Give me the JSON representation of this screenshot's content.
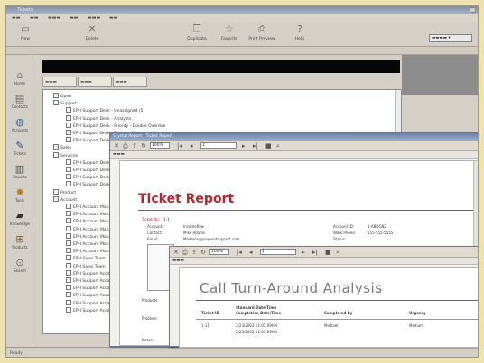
{
  "app": {
    "title": "Tickets"
  },
  "colors": {
    "accent_red": "#b02a32",
    "window_bg": "#d4d0c8",
    "background": "#ede3b0"
  },
  "toolbar": {
    "buttons": [
      {
        "icon": "new-icon",
        "label": "New"
      },
      {
        "icon": "delete-icon",
        "label": "Delete"
      },
      {
        "icon": "duplicate-icon",
        "label": "Duplicate"
      },
      {
        "icon": "favorite-icon",
        "label": "Favorite"
      },
      {
        "icon": "print-icon",
        "label": "Print Preview"
      },
      {
        "icon": "help-icon",
        "label": "Help"
      }
    ]
  },
  "leftbar": {
    "items": [
      {
        "icon": "home-icon",
        "label": "Home"
      },
      {
        "icon": "contacts-icon",
        "label": "Contacts"
      },
      {
        "icon": "globe-icon",
        "label": "Accounts"
      },
      {
        "icon": "pen-icon",
        "label": "Tickets"
      },
      {
        "icon": "chart-icon",
        "label": "Reports"
      },
      {
        "icon": "gear-icon",
        "label": "Tools"
      },
      {
        "icon": "book-icon",
        "label": "Knowledge"
      },
      {
        "icon": "box-icon",
        "label": "Products"
      },
      {
        "icon": "search-icon",
        "label": "Search"
      }
    ]
  },
  "tree": {
    "nodes": [
      {
        "text": "Open",
        "indent": 1
      },
      {
        "text": "Support",
        "indent": 1
      },
      {
        "text": "EPH Support Desk - Unassigned (5)",
        "indent": 3
      },
      {
        "text": "EPH Support Desk - Analysts",
        "indent": 3
      },
      {
        "text": "EPH Support Desk - Priority - Double Overdue",
        "indent": 3
      },
      {
        "text": "EPH Support Desk - Priority - Overdue (4)",
        "indent": 3
      },
      {
        "text": "EPH Support Desk",
        "indent": 3
      },
      {
        "text": "Sales",
        "indent": 1
      },
      {
        "text": "Services",
        "indent": 1
      },
      {
        "text": "EPH Support Desk",
        "indent": 3
      },
      {
        "text": "EPH Support Desk",
        "indent": 3
      },
      {
        "text": "EPH Support Desk",
        "indent": 3
      },
      {
        "text": "EPH Support Desk",
        "indent": 3
      },
      {
        "text": "Product",
        "indent": 1
      },
      {
        "text": "Account",
        "indent": 1
      },
      {
        "text": "EPH Account Mana",
        "indent": 3
      },
      {
        "text": "EPH Account Mana",
        "indent": 3
      },
      {
        "text": "EPH Account Mana",
        "indent": 3
      },
      {
        "text": "EPH Account Mana",
        "indent": 3
      },
      {
        "text": "EPH Account Mana",
        "indent": 3
      },
      {
        "text": "EPH Account Mana",
        "indent": 3
      },
      {
        "text": "EPH Account Mana",
        "indent": 3
      },
      {
        "text": "EPH Sales Team",
        "indent": 3
      },
      {
        "text": "EPH Sales Team",
        "indent": 3
      },
      {
        "text": "EPH Support Acco",
        "indent": 3
      },
      {
        "text": "EPH Support Acco",
        "indent": 3
      },
      {
        "text": "EPH Support Acco",
        "indent": 3
      },
      {
        "text": "EPH Support Acco",
        "indent": 3
      },
      {
        "text": "EPH Support Acco",
        "indent": 3
      },
      {
        "text": "EPH Support Acco",
        "indent": 3
      }
    ]
  },
  "report_window": {
    "title": "Crystal Report - Ticket Report",
    "report_title": "Ticket Report",
    "fields": [
      {
        "label": "Ticket No:",
        "value": "1-1"
      },
      {
        "label": "Account:",
        "value": "Incomeflow"
      },
      {
        "label": "Contact:",
        "value": "Mike Adams"
      },
      {
        "label": "Email:",
        "value": "Madams@pinpointsupport.com"
      }
    ],
    "right_fields": [
      {
        "label": "Account ID:",
        "value": "1-ABDGN2"
      },
      {
        "label": "Work Phone:",
        "value": "555-555-5555"
      },
      {
        "label": "Status:",
        "value": ""
      }
    ],
    "side_labels": [
      "Products:",
      "Problem:",
      "Notes:"
    ]
  },
  "analysis_window": {
    "title": "Call Turn-Around Analysis",
    "columns": [
      "Ticket ID",
      "Standard Date/Time Completion Date/Time",
      "Completed By",
      "Urgency"
    ],
    "rows": [
      [
        "1-11",
        "2/23/2003 11:01:09AM",
        "Michael",
        "Medium"
      ],
      [
        "",
        "2/23/2003 11:01:09AM",
        "",
        ""
      ]
    ]
  },
  "status": {
    "text": "Ready"
  }
}
